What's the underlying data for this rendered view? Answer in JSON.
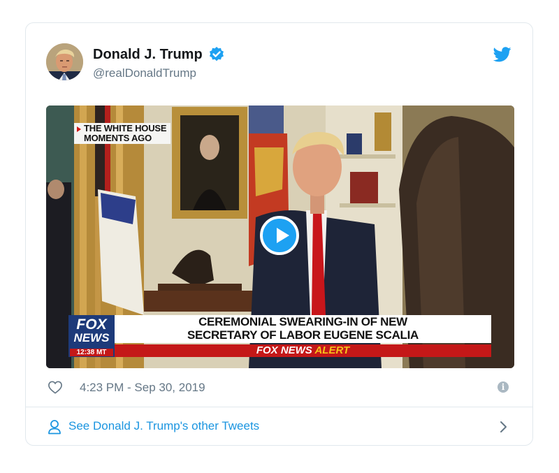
{
  "tweet": {
    "author_name": "Donald J. Trump",
    "handle": "@realDonaldTrump",
    "timestamp": "4:23 PM - Sep 30, 2019"
  },
  "video": {
    "location_tag_line1": "THE WHITE HOUSE",
    "location_tag_line2": "MOMENTS AGO",
    "logo_line1": "FOX",
    "logo_line2": "NEWS",
    "logo_time": "12:38 MT",
    "headline_line1": "CEREMONIAL SWEARING-IN OF NEW",
    "headline_line2": "SECRETARY OF LABOR EUGENE SCALIA",
    "alert_brand": "FOX NEWS",
    "alert_word": "ALERT"
  },
  "footer": {
    "link_label": "See Donald J. Trump's other Tweets"
  },
  "colors": {
    "accent": "#1da1f2",
    "link": "#1b95e0",
    "muted": "#657786",
    "border": "#e1e8ed",
    "fox_red": "#c41818",
    "fox_blue": "#1d3a7a"
  },
  "icons": [
    "verified-badge-icon",
    "twitter-bird-icon",
    "play-icon",
    "heart-icon",
    "info-icon",
    "person-icon",
    "chevron-right-icon"
  ]
}
